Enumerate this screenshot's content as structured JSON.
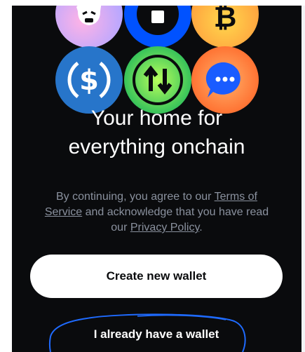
{
  "icons": [
    {
      "name": "ghost-token-icon",
      "color": "#c8a6ff"
    },
    {
      "name": "coinbase-coin-icon",
      "color": "#0052ff"
    },
    {
      "name": "bitcoin-icon",
      "color": "#ffb23c"
    },
    {
      "name": "usdc-icon",
      "color": "#2775ca"
    },
    {
      "name": "swap-icon",
      "color": "#2fbf5a"
    },
    {
      "name": "chat-icon",
      "color": "#ff6a2b"
    }
  ],
  "headline": {
    "line1": "Your home for",
    "line2": "everything onchain"
  },
  "legal": {
    "prefix": "By continuing, you agree to our ",
    "terms": "Terms of Service",
    "middle": " and acknowledge that you have read our ",
    "privacy": "Privacy Policy",
    "suffix": "."
  },
  "buttons": {
    "create": "Create new wallet",
    "have": "I already have a wallet"
  },
  "colors": {
    "background": "#0a0b0d",
    "primary_button": "#ffffff",
    "muted_text": "#8a919e",
    "annotation_stroke": "#1f6bff"
  }
}
